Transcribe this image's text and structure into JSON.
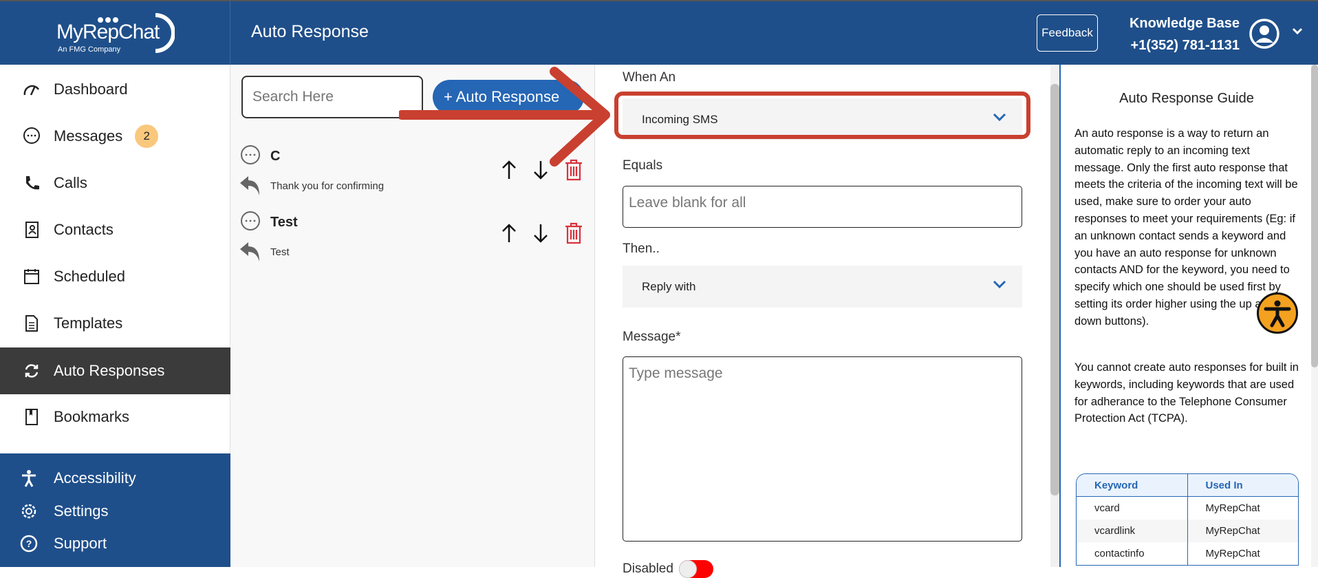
{
  "logo": {
    "name": "MyRepChat",
    "tagline": "An FMG Company"
  },
  "header": {
    "title": "Auto Response",
    "feedback": "Feedback",
    "kb_title": "Knowledge Base",
    "phone": "+1(352) 781-1131"
  },
  "sidebar": {
    "items": [
      {
        "label": "Dashboard",
        "icon": "gauge-icon"
      },
      {
        "label": "Messages",
        "icon": "chat-icon",
        "badge": "2"
      },
      {
        "label": "Calls",
        "icon": "phone-icon"
      },
      {
        "label": "Contacts",
        "icon": "contacts-icon"
      },
      {
        "label": "Scheduled",
        "icon": "calendar-icon"
      },
      {
        "label": "Templates",
        "icon": "document-icon"
      },
      {
        "label": "Auto Responses",
        "icon": "refresh-icon",
        "active": true
      },
      {
        "label": "Bookmarks",
        "icon": "bookmark-icon"
      }
    ],
    "bottom": [
      {
        "label": "Accessibility"
      },
      {
        "label": "Settings"
      },
      {
        "label": "Support"
      }
    ]
  },
  "list": {
    "search_placeholder": "Search Here",
    "add_label": "+ Auto Response",
    "items": [
      {
        "name": "C",
        "reply": "Thank you for confirming"
      },
      {
        "name": "Test",
        "reply": "Test"
      }
    ]
  },
  "form": {
    "when_label": "When An",
    "when_value": "Incoming SMS",
    "equals_label": "Equals",
    "equals_placeholder": "Leave blank for all",
    "then_label": "Then..",
    "then_value": "Reply with",
    "message_label": "Message*",
    "message_placeholder": "Type message",
    "disabled_label": "Disabled"
  },
  "guide": {
    "title": "Auto Response Guide",
    "p1": "An auto response is a way to return an automatic reply to an incoming text message. Only the first auto response that meets the criteria of the incoming text will be used, make sure to order your auto responses to meet your requirements (Eg: if an unknown contact sends a keyword and you have an auto response for unknown contacts AND for the keyword, you need to specify which one should be used first by setting its order higher using the up and down buttons).",
    "p2": "You cannot create auto responses for built in keywords, including keywords that are used for adherance to the Telephone Consumer Protection Act (TCPA).",
    "table": {
      "headers": [
        "Keyword",
        "Used In"
      ],
      "rows": [
        [
          "vcard",
          "MyRepChat"
        ],
        [
          "vcardlink",
          "MyRepChat"
        ],
        [
          "contactinfo",
          "MyRepChat"
        ]
      ]
    }
  },
  "colors": {
    "brand": "#1f4f8a",
    "accent": "#2566b5",
    "annotation": "#c94030",
    "delete": "#d9313c"
  }
}
